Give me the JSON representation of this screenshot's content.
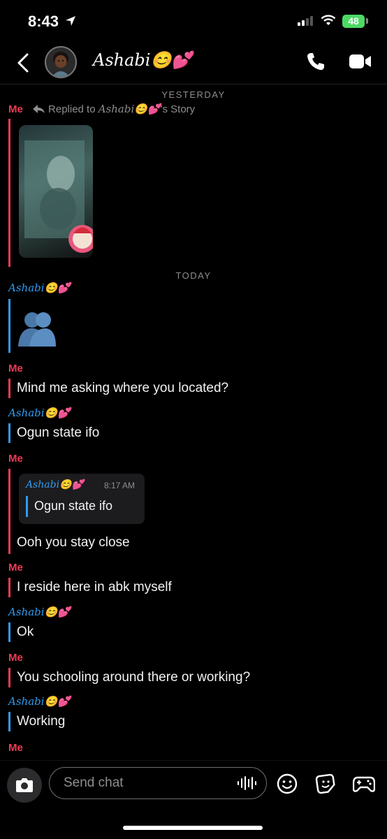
{
  "status": {
    "time": "8:43",
    "battery": "48"
  },
  "header": {
    "contact_name": "Ashabi😊💕"
  },
  "chat": {
    "day_yesterday": "YESTERDAY",
    "reply_context": {
      "sender": "Me",
      "prefix": "Replied to ",
      "name": "Ashabi😊💕",
      "suffix": "'s Story"
    },
    "day_today": "TODAY",
    "me_label": "Me",
    "them_label": "Ashabi😊💕",
    "messages": [
      {
        "text": "Mind me asking where you located?"
      },
      {
        "text": "Ogun state ifo"
      },
      {
        "quote_name": "Ashabi😊💕",
        "quote_time": "8:17 AM",
        "quote_text": "Ogun state ifo",
        "text": "Ooh you stay close"
      },
      {
        "text": "I reside here in abk myself"
      },
      {
        "text": "Ok"
      },
      {
        "text": "You schooling around there or working?"
      },
      {
        "text": "Working"
      }
    ]
  },
  "composer": {
    "placeholder": "Send chat"
  },
  "icons": [
    "back-icon",
    "phone-icon",
    "video-icon",
    "camera-icon",
    "mic-icon",
    "smile-icon",
    "sticker-icon",
    "game-icon",
    "location-arrow-icon",
    "signal-icon",
    "wifi-icon"
  ]
}
